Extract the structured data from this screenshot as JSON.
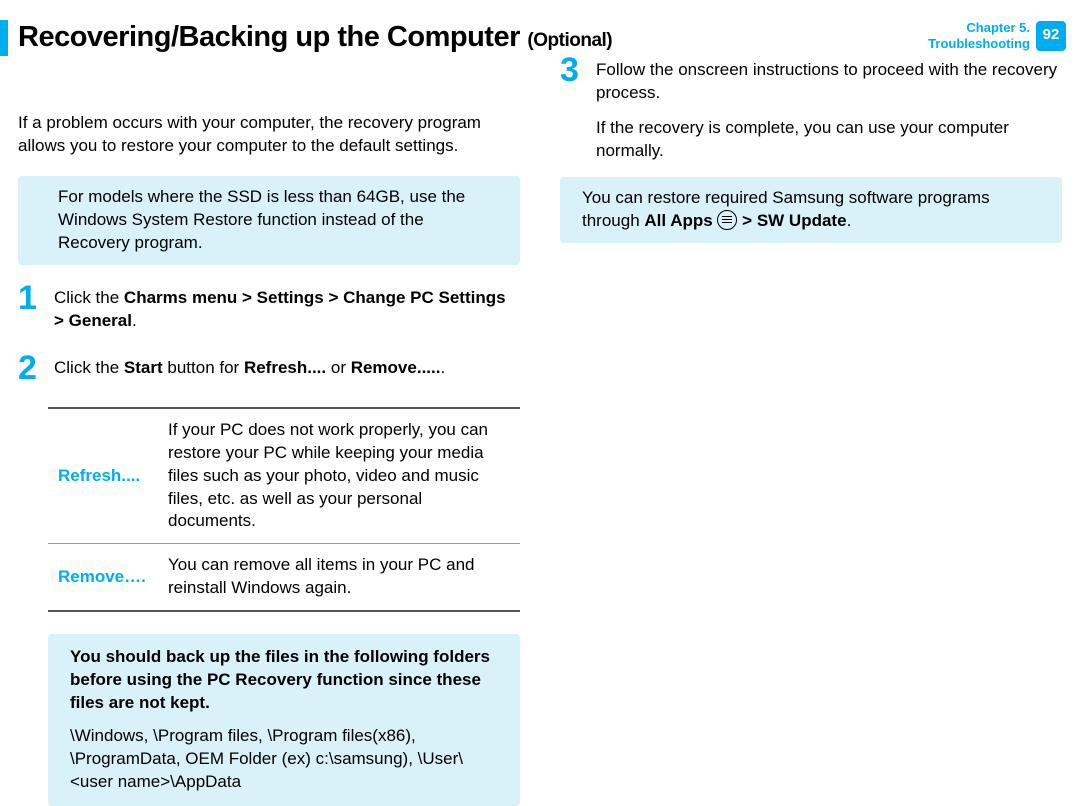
{
  "header": {
    "title_main": "Recovering/Backing up the Computer",
    "title_suffix": "(Optional)",
    "chapter_line1": "Chapter 5.",
    "chapter_line2": "Troubleshooting",
    "page_number": "92"
  },
  "left": {
    "intro": "If a problem occurs with your computer, the recovery program allows you to restore your computer to the default settings.",
    "ssd_note": "For models where the SSD is less than 64GB, use the Windows System Restore function instead of the Recovery program.",
    "step1": {
      "num": "1",
      "prefix": "Click the ",
      "bold": "Charms menu > Settings > Change PC Settings > General",
      "suffix": "."
    },
    "step2": {
      "num": "2",
      "t1": "Click the ",
      "b1": "Start",
      "t2": " button for ",
      "b2": "Refresh....",
      "t3": " or ",
      "b3": "Remove.....",
      "t4": "."
    },
    "options": {
      "refresh": {
        "label": "Refresh....",
        "desc": "If your PC does not work properly, you can restore your PC while keeping your media files such as your photo, video and music files, etc. as well as your personal documents."
      },
      "remove": {
        "label": "Remove….",
        "desc": "You can remove all items in your PC and reinstall Windows again."
      }
    },
    "warn": {
      "title": "You should back up the files in the following folders before using the PC Recovery function since these files are not kept.",
      "body": "\\Windows, \\Program files, \\Program files(x86), \\ProgramData, OEM Folder (ex) c:\\samsung), \\User\\<user name>\\AppData"
    }
  },
  "right": {
    "step3": {
      "num": "3",
      "text": "Follow the onscreen instructions to proceed with the recovery process."
    },
    "after_step3": "If the recovery is complete, you can use your computer normally.",
    "restore_note": {
      "t1": "You can restore required Samsung software programs through ",
      "b1": "All Apps",
      "t2": " > ",
      "b2": "SW Update",
      "t3": "."
    }
  }
}
